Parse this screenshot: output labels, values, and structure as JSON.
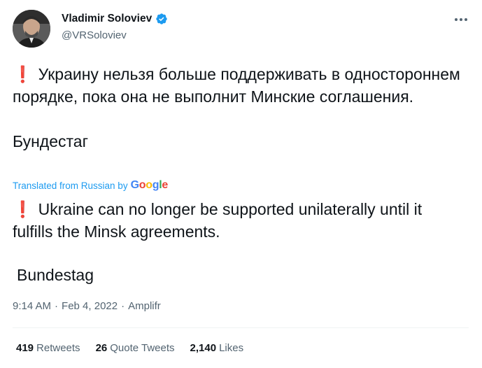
{
  "author": {
    "display_name": "Vladimir Soloviev",
    "handle": "@VRSoloviev",
    "verified": true
  },
  "tweet": {
    "original_line": "Украину нельзя больше поддерживать в одностороннем порядке, пока она не выполнит Минские соглашения.",
    "original_source": "Бундестаг",
    "translated_label": "Translated from Russian by",
    "translator": "Google",
    "translated_line": "Ukraine can no longer be supported unilaterally until it fulfills the Minsk agreements.",
    "translated_source": "Bundestag"
  },
  "meta": {
    "time": "9:14 AM",
    "date": "Feb 4, 2022",
    "client": "Amplifr",
    "separator": "·"
  },
  "stats": {
    "retweets_count": "419",
    "retweets_label": "Retweets",
    "quotes_count": "26",
    "quotes_label": "Quote Tweets",
    "likes_count": "2,140",
    "likes_label": "Likes"
  },
  "icons": {
    "verified": "verified-badge-icon",
    "more": "more-options-icon",
    "exclamation": "exclamation-mark-icon"
  },
  "colors": {
    "verified_blue": "#1d9bf0",
    "link_blue": "#1d9bf0",
    "exclamation_red": "#dd2e44",
    "secondary_text": "#536471"
  }
}
